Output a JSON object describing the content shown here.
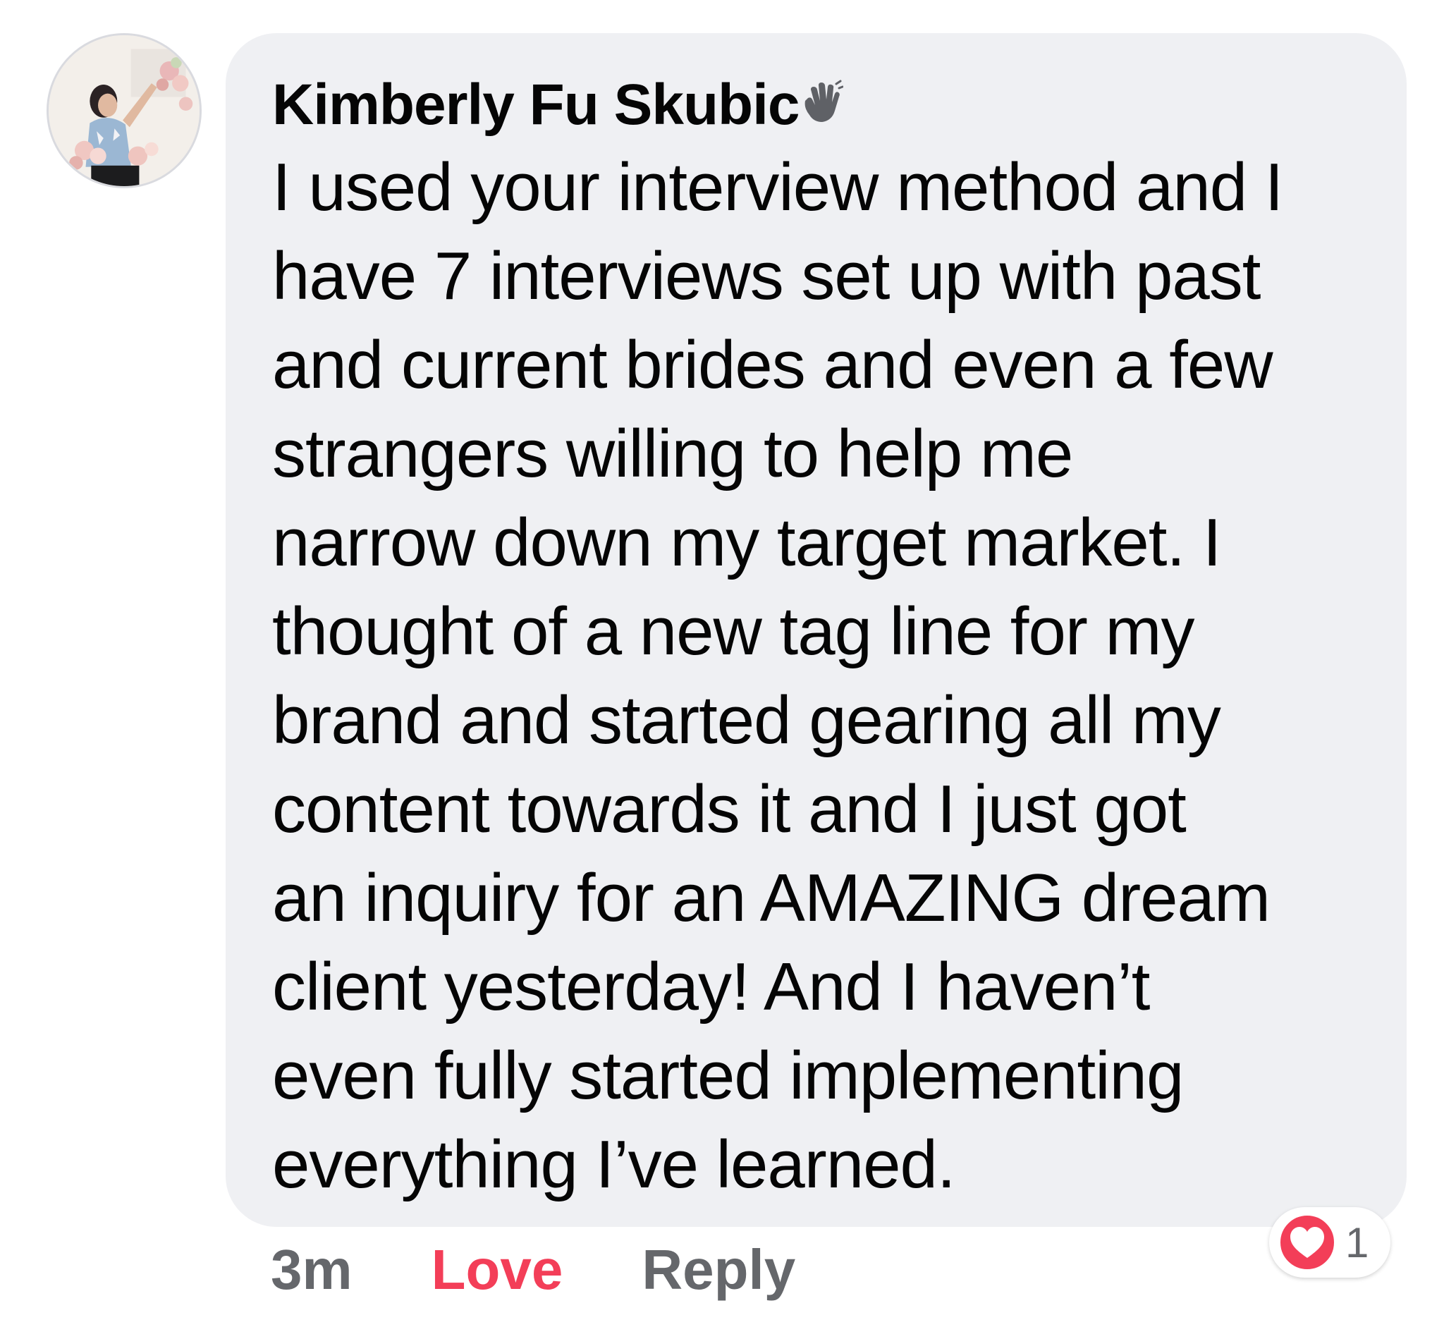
{
  "comment": {
    "author": "Kimberly Fu Skubic",
    "author_badge_icon": "waving-hand-icon",
    "text_lines": [
      "I used your interview method and I",
      "have 7 interviews set up with past",
      "and current brides and even a few",
      "strangers willing to help me",
      "narrow down my target market. I",
      "thought of a new tag line for my",
      "brand and started gearing all my",
      "content towards it and I just got",
      "an inquiry for an AMAZING dream",
      "client yesterday! And I haven’t",
      "even fully started implementing",
      "everything I’ve learned."
    ],
    "bubble_color": "#eff0f3"
  },
  "actions": {
    "time": "3m",
    "love_label": "Love",
    "reply_label": "Reply",
    "love_color": "#f33e58",
    "muted_color": "#65676b"
  },
  "reactions": {
    "icon": "heart-icon",
    "count": "1",
    "color": "#f33e58"
  },
  "avatar": {
    "icon": "profile-photo"
  }
}
